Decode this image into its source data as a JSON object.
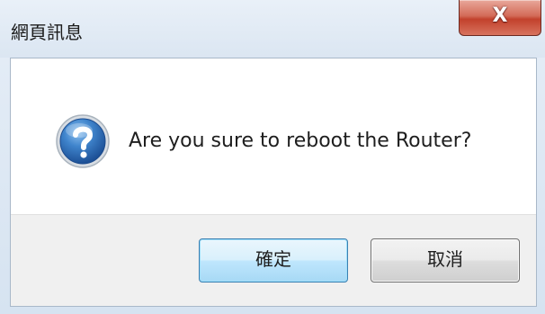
{
  "dialog": {
    "title": "網頁訊息",
    "close_label": "X",
    "message": "Are you sure to reboot the Router?",
    "icon": "question-icon",
    "ok_label": "確定",
    "cancel_label": "取消"
  },
  "colors": {
    "icon_blue": "#2f6fb5",
    "ok_border": "#3c7fb1",
    "close_red": "#c2412c"
  }
}
